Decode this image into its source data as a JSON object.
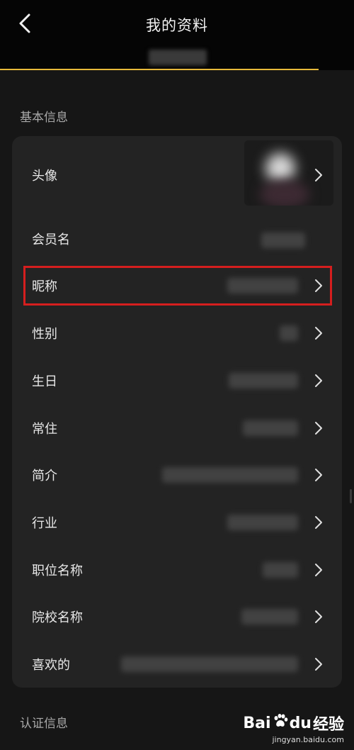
{
  "header": {
    "title": "我的资料"
  },
  "sections": {
    "basic": "基本信息",
    "verify": "认证信息"
  },
  "rows": [
    {
      "label": "头像"
    },
    {
      "label": "会员名"
    },
    {
      "label": "昵称"
    },
    {
      "label": "性别"
    },
    {
      "label": "生日"
    },
    {
      "label": "常住"
    },
    {
      "label": "简介"
    },
    {
      "label": "行业"
    },
    {
      "label": "职位名称"
    },
    {
      "label": "院校名称"
    },
    {
      "label": "喜欢的"
    }
  ],
  "watermark": {
    "brand": "Bai",
    "paw": "du",
    "suffix": "经验",
    "url": "jingyan.baidu.com"
  },
  "colors": {
    "accent": "#e7b93a",
    "highlight": "#d51e1e",
    "background": "#161616",
    "card": "#232323"
  }
}
